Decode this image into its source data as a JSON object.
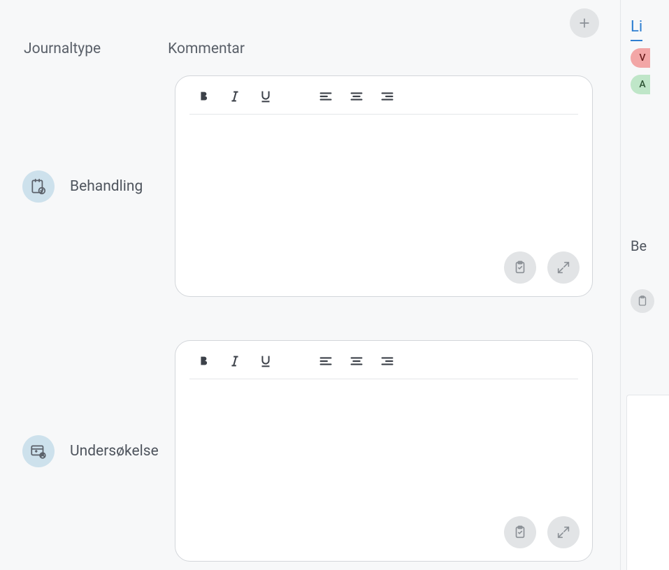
{
  "headers": {
    "journaltype": "Journaltype",
    "kommentar": "Kommentar"
  },
  "rows": [
    {
      "label": "Behandling",
      "icon": "clipboard-check"
    },
    {
      "label": "Undersøkelse",
      "icon": "medical-id"
    }
  ],
  "side": {
    "link": "Li",
    "chip1": "V",
    "chip2": "A",
    "heading": "Be"
  }
}
